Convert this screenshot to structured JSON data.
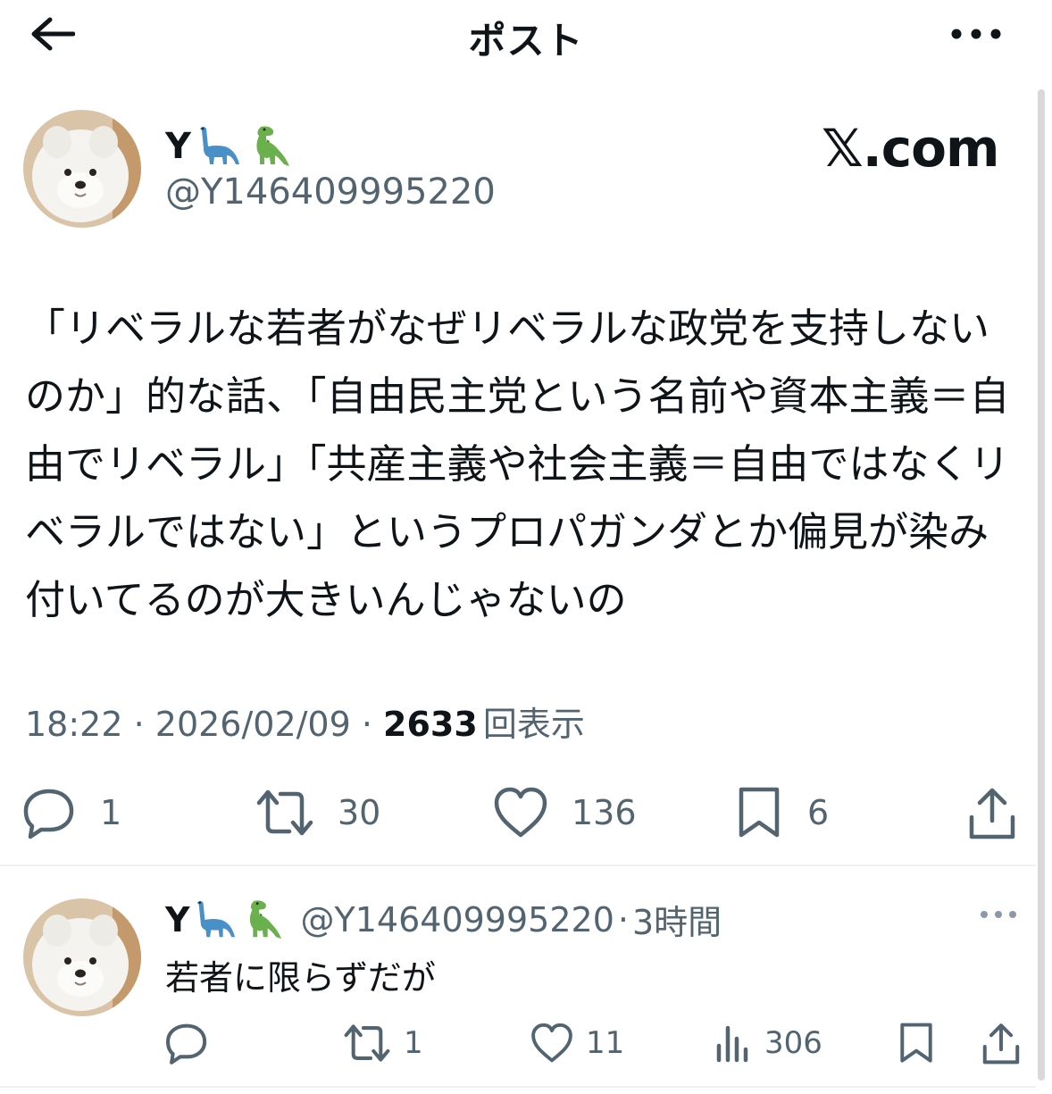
{
  "header": {
    "title": "ポスト"
  },
  "post": {
    "author_name": "Y",
    "author_emojis": [
      "sauropod",
      "t-rex"
    ],
    "handle": "@Y146409995220",
    "watermark": "𝕏.com",
    "text": "「リベラルな若者がなぜリベラルな政党を支持しないのか」的な話、「自由民主党という名前や資本主義＝自由でリベラル」「共産主義や社会主義＝自由ではなくリベラルではない」というプロパガンダとか偏見が染み付いてるのが大きいんじゃないの",
    "time": "18:22",
    "separator": " · ",
    "date": "2026/02/09",
    "views_count": "2633",
    "views_label": "回表示",
    "actions": {
      "replies": "1",
      "reposts": "30",
      "likes": "136",
      "bookmarks": "6"
    }
  },
  "reply": {
    "author_name": "Y",
    "handle": "@Y146409995220",
    "time_ago": "3時間",
    "separator": "·",
    "text": "若者に限らずだが",
    "actions": {
      "replies": "",
      "reposts": "1",
      "likes": "11",
      "views": "306"
    }
  },
  "colors": {
    "text_primary": "#0f1419",
    "text_secondary": "#536471",
    "divider": "#eff3f4"
  }
}
